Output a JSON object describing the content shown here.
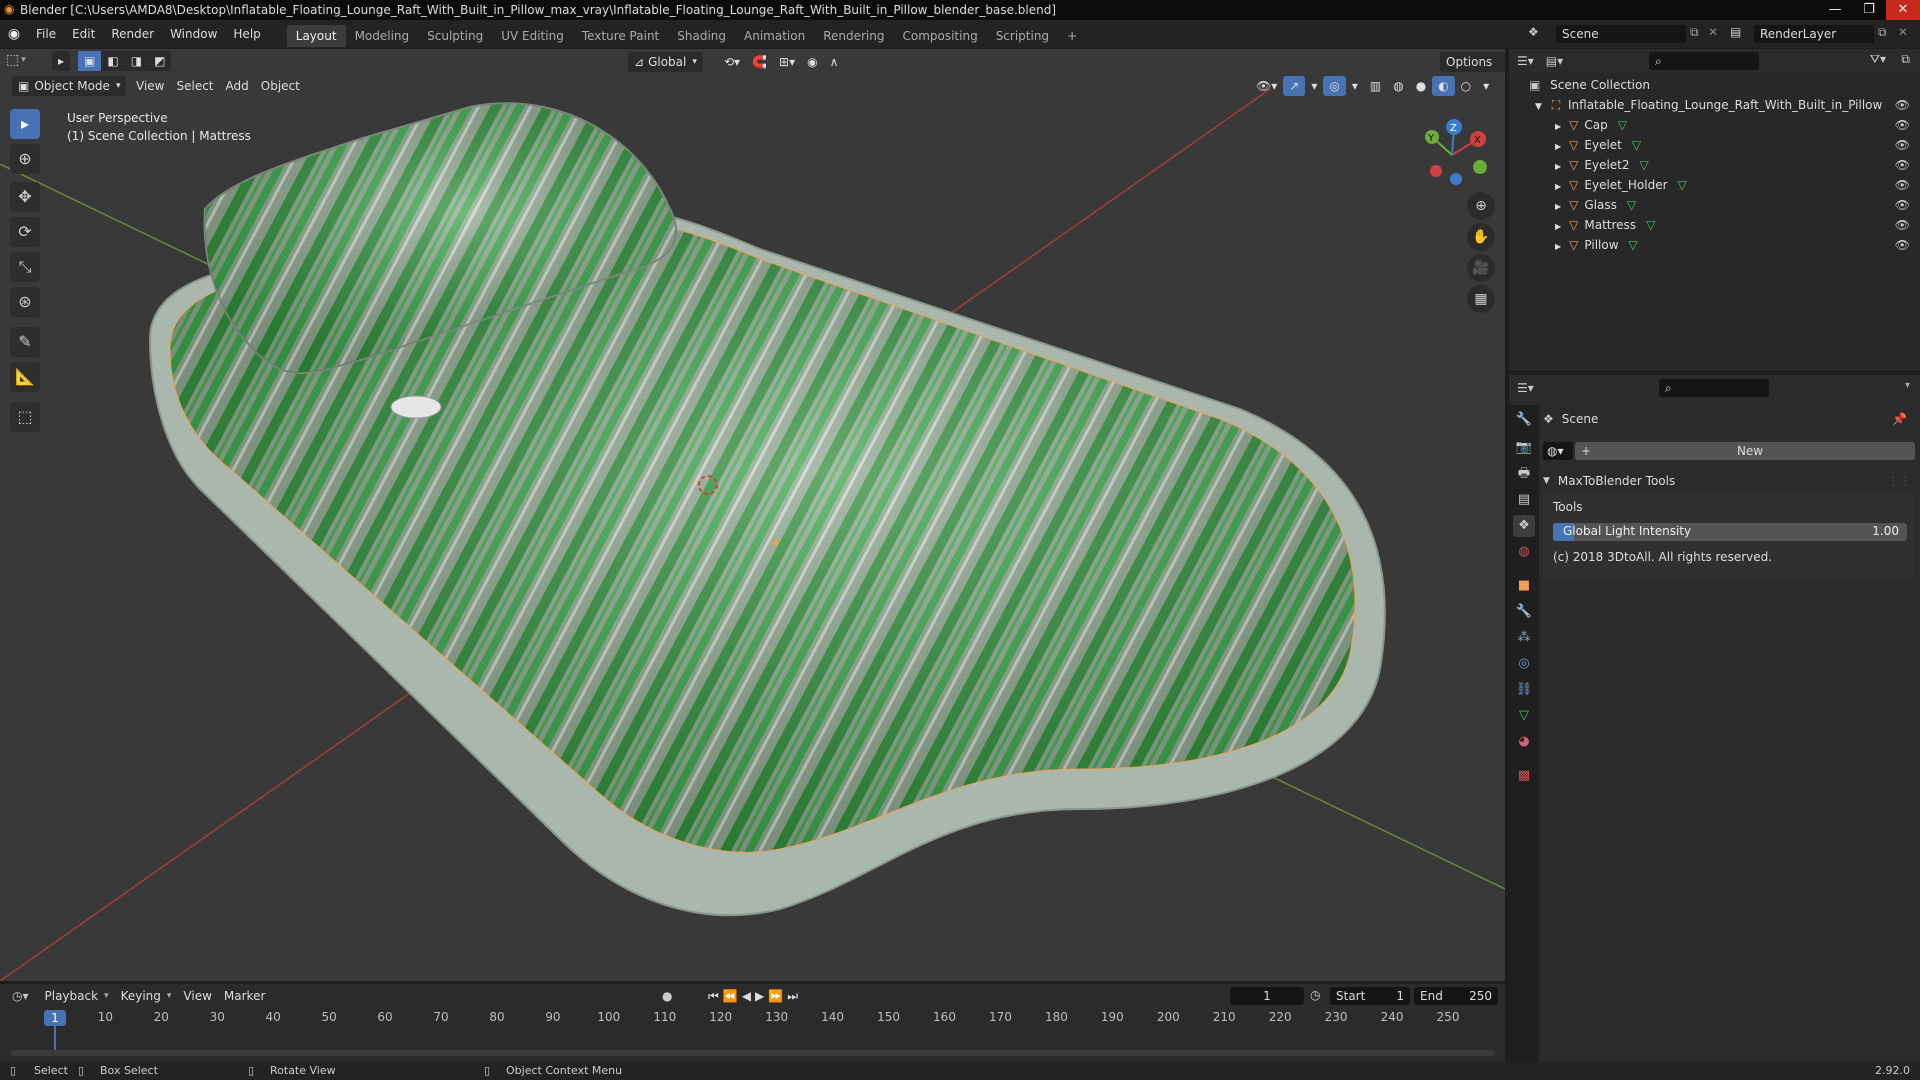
{
  "window": {
    "title": "Blender [C:\\Users\\AMDA8\\Desktop\\Inflatable_Floating_Lounge_Raft_With_Built_in_Pillow_max_vray\\Inflatable_Floating_Lounge_Raft_With_Built_in_Pillow_blender_base.blend]",
    "minimize": "—",
    "maximize": "❐",
    "close": "✕"
  },
  "menu": [
    "File",
    "Edit",
    "Render",
    "Window",
    "Help"
  ],
  "workspaces": [
    {
      "label": "Layout",
      "active": true
    },
    {
      "label": "Modeling",
      "active": false
    },
    {
      "label": "Sculpting",
      "active": false
    },
    {
      "label": "UV Editing",
      "active": false
    },
    {
      "label": "Texture Paint",
      "active": false
    },
    {
      "label": "Shading",
      "active": false
    },
    {
      "label": "Animation",
      "active": false
    },
    {
      "label": "Rendering",
      "active": false
    },
    {
      "label": "Compositing",
      "active": false
    },
    {
      "label": "Scripting",
      "active": false
    }
  ],
  "add_workspace": "+",
  "scene": {
    "name": "Scene",
    "render_layer": "RenderLayer"
  },
  "viewport": {
    "mode": "Object Mode",
    "header_menus": [
      "View",
      "Select",
      "Add",
      "Object"
    ],
    "orientation": "Global",
    "options": "Options",
    "overlay_line1": "User Perspective",
    "overlay_line2": "(1) Scene Collection | Mattress",
    "gizmo": {
      "x": "X",
      "y": "Y",
      "z": "Z"
    }
  },
  "tools": [
    "select-box",
    "cursor",
    "move",
    "rotate",
    "scale",
    "transform",
    "annotate",
    "measure",
    "add-cube"
  ],
  "outliner": {
    "root": "Scene Collection",
    "collection": "Inflatable_Floating_Lounge_Raft_With_Built_in_Pillow",
    "objects": [
      "Cap",
      "Eyelet",
      "Eyelet2",
      "Eyelet_Holder",
      "Glass",
      "Mattress",
      "Pillow"
    ]
  },
  "properties": {
    "context": "Scene",
    "new_button": "New",
    "panel_title": "MaxToBlender Tools",
    "section": "Tools",
    "slider_label": "Global Light Intensity",
    "slider_value": "1.00",
    "slider_fraction": 0.06,
    "copyright": "(c) 2018 3DtoAll. All rights reserved."
  },
  "timeline": {
    "menus": [
      "Playback",
      "Keying",
      "View",
      "Marker"
    ],
    "current_frame": "1",
    "start_label": "Start",
    "start": "1",
    "end_label": "End",
    "end": "250",
    "ticks": [
      "1",
      "10",
      "20",
      "30",
      "40",
      "50",
      "60",
      "70",
      "80",
      "90",
      "100",
      "110",
      "120",
      "130",
      "140",
      "150",
      "160",
      "170",
      "180",
      "190",
      "200",
      "210",
      "220",
      "230",
      "240",
      "250"
    ]
  },
  "status": {
    "select": "Select",
    "box_select": "Box Select",
    "rotate_view": "Rotate View",
    "context_menu": "Object Context Menu",
    "version": "2.92.0"
  },
  "colors": {
    "accent": "#4772b3",
    "active_object": "#f0a050",
    "mesh_green": "#3aa64b"
  }
}
